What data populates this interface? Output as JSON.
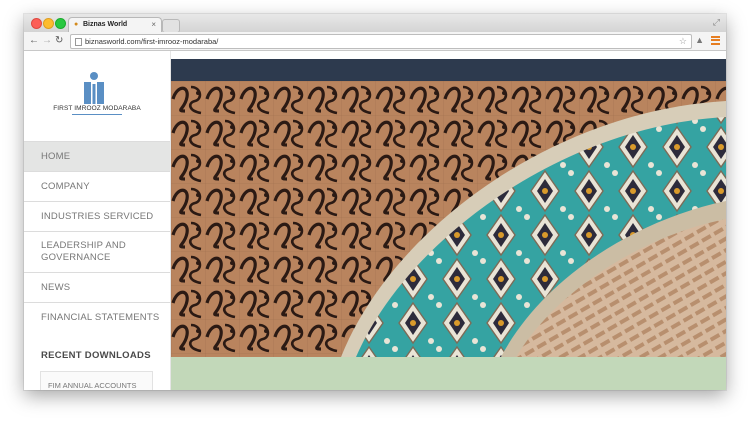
{
  "browser": {
    "tab_title": "Biznas World",
    "url": "biznasworld.com/first-imrooz-modaraba/"
  },
  "site": {
    "logo_text": "FIRST IMROOZ MODARABA",
    "nav": [
      {
        "label": "HOME",
        "active": true
      },
      {
        "label": "COMPANY",
        "active": false
      },
      {
        "label": "INDUSTRIES SERVICED",
        "active": false
      },
      {
        "label": "LEADERSHIP AND GOVERNANCE",
        "active": false
      },
      {
        "label": "NEWS",
        "active": false
      },
      {
        "label": "FINANCIAL STATEMENTS",
        "active": false
      }
    ],
    "recent_downloads": {
      "heading": "RECENT DOWNLOADS",
      "items": [
        "FIM ANNUAL ACCOUNTS"
      ]
    }
  },
  "colors": {
    "header_band": "#2d3a4e",
    "green_band": "#c2d8b9",
    "active_nav": "#e4e5e4",
    "logo_blue": "#5a8fc4"
  },
  "icons": [
    "back-icon",
    "forward-icon",
    "reload-icon",
    "page-icon",
    "star-icon",
    "extension-icon",
    "menu-icon",
    "close-icon"
  ]
}
